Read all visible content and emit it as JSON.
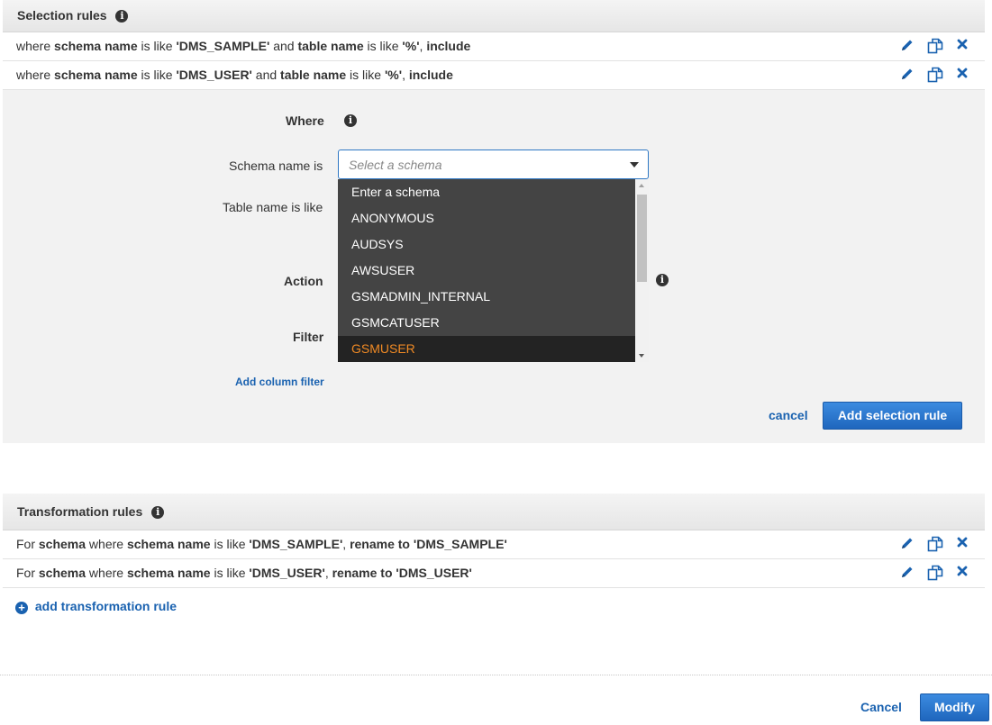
{
  "selection": {
    "title": "Selection rules",
    "rules": [
      {
        "p1": "where ",
        "b1": "schema name",
        "p2": " is like ",
        "b2": "'DMS_SAMPLE'",
        "p3": " and ",
        "b3": "table name",
        "p4": " is like ",
        "b4": "'%'",
        "p5": ", ",
        "b5": "include"
      },
      {
        "p1": "where ",
        "b1": "schema name",
        "p2": " is like ",
        "b2": "'DMS_USER'",
        "p3": " and ",
        "b3": "table name",
        "p4": " is like ",
        "b4": "'%'",
        "p5": ", ",
        "b5": "include"
      }
    ],
    "form": {
      "where_label": "Where",
      "schema_label": "Schema name is",
      "schema_placeholder": "Select a schema",
      "table_label": "Table name is like",
      "action_label": "Action",
      "filter_label": "Filter",
      "add_column_filter": "Add column filter",
      "cancel": "cancel",
      "add_rule": "Add selection rule"
    },
    "dropdown_options": [
      "Enter a schema",
      "ANONYMOUS",
      "AUDSYS",
      "AWSUSER",
      "GSMADMIN_INTERNAL",
      "GSMCATUSER",
      "GSMUSER"
    ],
    "dropdown_active": "GSMUSER"
  },
  "transformation": {
    "title": "Transformation rules",
    "rules": [
      {
        "p1": "For ",
        "b1": "schema",
        "p2": " where ",
        "b2": "schema name",
        "p3": " is like ",
        "b3": "'DMS_SAMPLE'",
        "p4": ", ",
        "b4": "rename to",
        "p5": " ",
        "b5": "'DMS_SAMPLE'"
      },
      {
        "p1": "For ",
        "b1": "schema",
        "p2": " where ",
        "b2": "schema name",
        "p3": " is like ",
        "b3": "'DMS_USER'",
        "p4": ", ",
        "b4": "rename to",
        "p5": " ",
        "b5": "'DMS_USER'"
      }
    ],
    "add_link": "add transformation rule"
  },
  "footer": {
    "cancel": "Cancel",
    "modify": "Modify"
  },
  "info_glyph": "i",
  "plus_glyph": "+",
  "icons": {
    "edit": "pencil-icon",
    "duplicate": "copy-icon",
    "remove": "close-icon",
    "info": "info-icon"
  },
  "colors": {
    "accent": "#1a62b0",
    "dropdown_bg": "#444444",
    "dropdown_active_text": "#f08a24"
  }
}
